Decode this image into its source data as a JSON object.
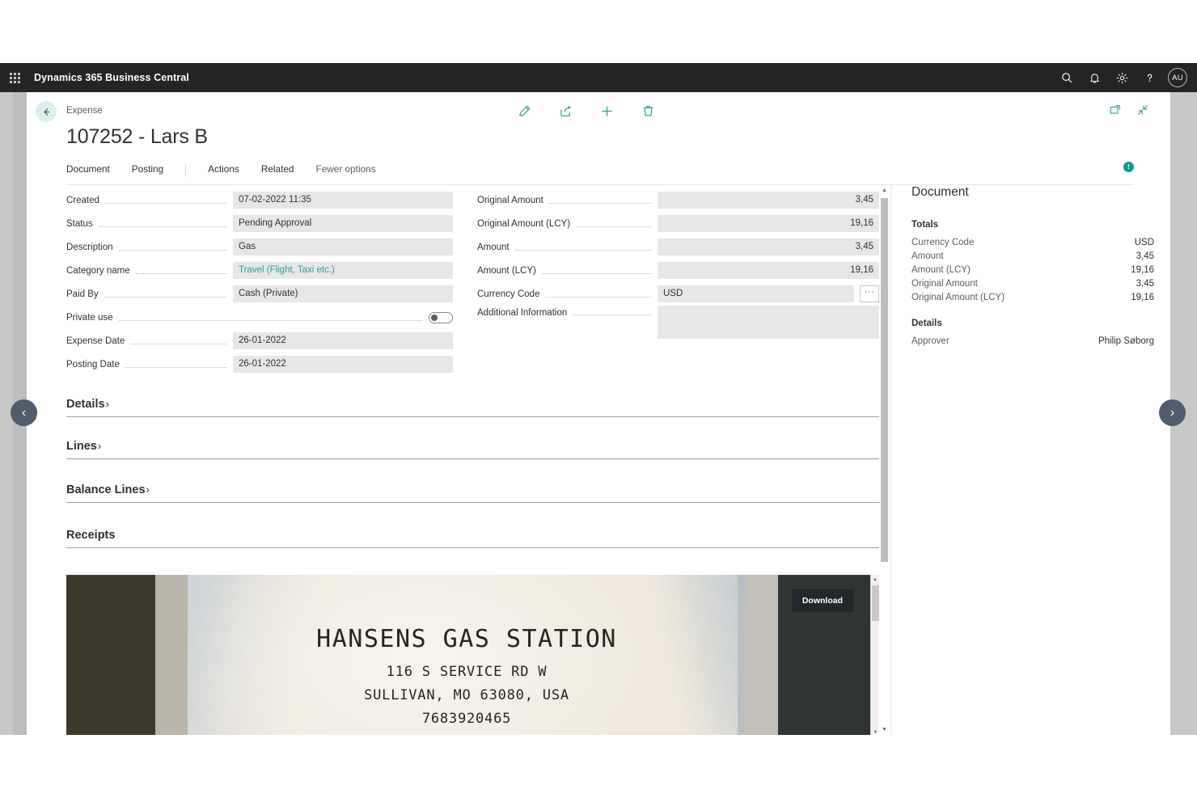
{
  "topbar": {
    "waffle_label": "App launcher",
    "brand": "Dynamics 365 Business Central",
    "icons": [
      "search-icon",
      "bell-icon",
      "gear-icon",
      "help-icon"
    ],
    "avatar_initials": "AU"
  },
  "page": {
    "breadcrumb": "Expense",
    "title": "107252 - Lars B",
    "back_label": "Back",
    "actions": [
      {
        "name": "edit-button",
        "icon": "pencil-icon"
      },
      {
        "name": "share-button",
        "icon": "share-icon"
      },
      {
        "name": "new-button",
        "icon": "plus-icon"
      },
      {
        "name": "delete-button",
        "icon": "trash-icon"
      }
    ],
    "header_right": [
      {
        "name": "open-in-new-window-button",
        "icon": "open-new-window-icon"
      },
      {
        "name": "minimize-button",
        "icon": "collapse-icon"
      }
    ],
    "notification_badge": "!"
  },
  "menubar": {
    "items": [
      {
        "label": "Document",
        "muted": false
      },
      {
        "label": "Posting",
        "muted": false
      },
      {
        "label": "Actions",
        "muted": false
      },
      {
        "label": "Related",
        "muted": false
      },
      {
        "label": "Fewer options",
        "muted": true
      }
    ]
  },
  "form": {
    "left_fields": [
      {
        "label": "Created",
        "value": "07-02-2022 11:35",
        "type": "text"
      },
      {
        "label": "Status",
        "value": "Pending Approval",
        "type": "text"
      },
      {
        "label": "Description",
        "value": "Gas",
        "type": "text"
      },
      {
        "label": "Category name",
        "value": "Travel (Flight, Taxi etc.)",
        "type": "link"
      },
      {
        "label": "Paid By",
        "value": "Cash (Private)",
        "type": "text"
      },
      {
        "label": "Private use",
        "value": "",
        "type": "toggle",
        "checked": false
      },
      {
        "label": "Expense Date",
        "value": "26-01-2022",
        "type": "text"
      },
      {
        "label": "Posting Date",
        "value": "26-01-2022",
        "type": "text"
      }
    ],
    "right_fields": [
      {
        "label": "Original Amount",
        "value": "3,45",
        "type": "number"
      },
      {
        "label": "Original Amount (LCY)",
        "value": "19,16",
        "type": "number"
      },
      {
        "label": "Amount",
        "value": "3,45",
        "type": "number"
      },
      {
        "label": "Amount (LCY)",
        "value": "19,16",
        "type": "number"
      },
      {
        "label": "Currency Code",
        "value": "USD",
        "type": "lookup",
        "lookup_glyph": "···"
      },
      {
        "label": "Additional Information",
        "value": "",
        "type": "textarea"
      }
    ]
  },
  "sections": [
    {
      "title": "Details",
      "chevron": "›",
      "expanded": false
    },
    {
      "title": "Lines",
      "chevron": "›",
      "expanded": false
    },
    {
      "title": "Balance Lines",
      "chevron": "›",
      "expanded": false
    },
    {
      "title": "Receipts",
      "chevron": "",
      "expanded": true
    }
  ],
  "receipt": {
    "download_label": "Download",
    "lines": {
      "name": "HANSENS GAS STATION",
      "street": "116 S SERVICE RD W",
      "city": "SULLIVAN, MO 63080, USA",
      "phone": "7683920465"
    }
  },
  "factbox": {
    "title": "Document",
    "totals_heading": "Totals",
    "totals": [
      {
        "label": "Currency Code",
        "value": "USD"
      },
      {
        "label": "Amount",
        "value": "3,45"
      },
      {
        "label": "Amount (LCY)",
        "value": "19,16"
      },
      {
        "label": "Original Amount",
        "value": "3,45"
      },
      {
        "label": "Original Amount (LCY)",
        "value": "19,16"
      }
    ],
    "details_heading": "Details",
    "details": [
      {
        "label": "Approver",
        "value": "Philip Søborg"
      }
    ]
  },
  "nav": {
    "prev_glyph": "‹",
    "next_glyph": "›"
  },
  "colors": {
    "topbar_bg": "#252423",
    "accent_teal": "#2f9e96",
    "badge_teal": "#0f9a96",
    "field_bg": "#e7e7e7",
    "nav_arrow_bg": "#4f5d6e"
  }
}
